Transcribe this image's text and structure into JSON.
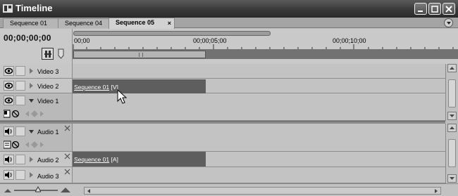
{
  "window": {
    "title": "Timeline"
  },
  "tabs": [
    {
      "label": "Sequence 01"
    },
    {
      "label": "Sequence 04"
    },
    {
      "label": "Sequence 05",
      "close": "×"
    }
  ],
  "timecode": "00;00;00;00",
  "ruler": {
    "labels": [
      "00;00",
      "00;00;05;00",
      "00;00;10;00"
    ]
  },
  "tracks": [
    {
      "name": "Video 3"
    },
    {
      "name": "Video 2"
    },
    {
      "name": "Video 1"
    },
    {
      "name": "Audio 1"
    },
    {
      "name": "Audio 2"
    },
    {
      "name": "Audio 3"
    }
  ],
  "clips": {
    "video2": {
      "name": "Sequence 01",
      "suffix": " [V]"
    },
    "audio2": {
      "name": "Sequence 01",
      "suffix": " [A]"
    }
  },
  "icons": [
    "app-icon",
    "minimize-icon",
    "maximize-icon",
    "close-icon",
    "panel-menu-icon",
    "snap-icon",
    "marker-icon",
    "eye-icon",
    "speaker-icon",
    "lock-icon",
    "twirl-icon",
    "keyframe-icon",
    "zoom-out-icon",
    "zoom-in-icon"
  ],
  "colors": {
    "titlebar": "#3a3a3a",
    "clip": "#5e5e5e",
    "panel": "#c3c3c3"
  }
}
